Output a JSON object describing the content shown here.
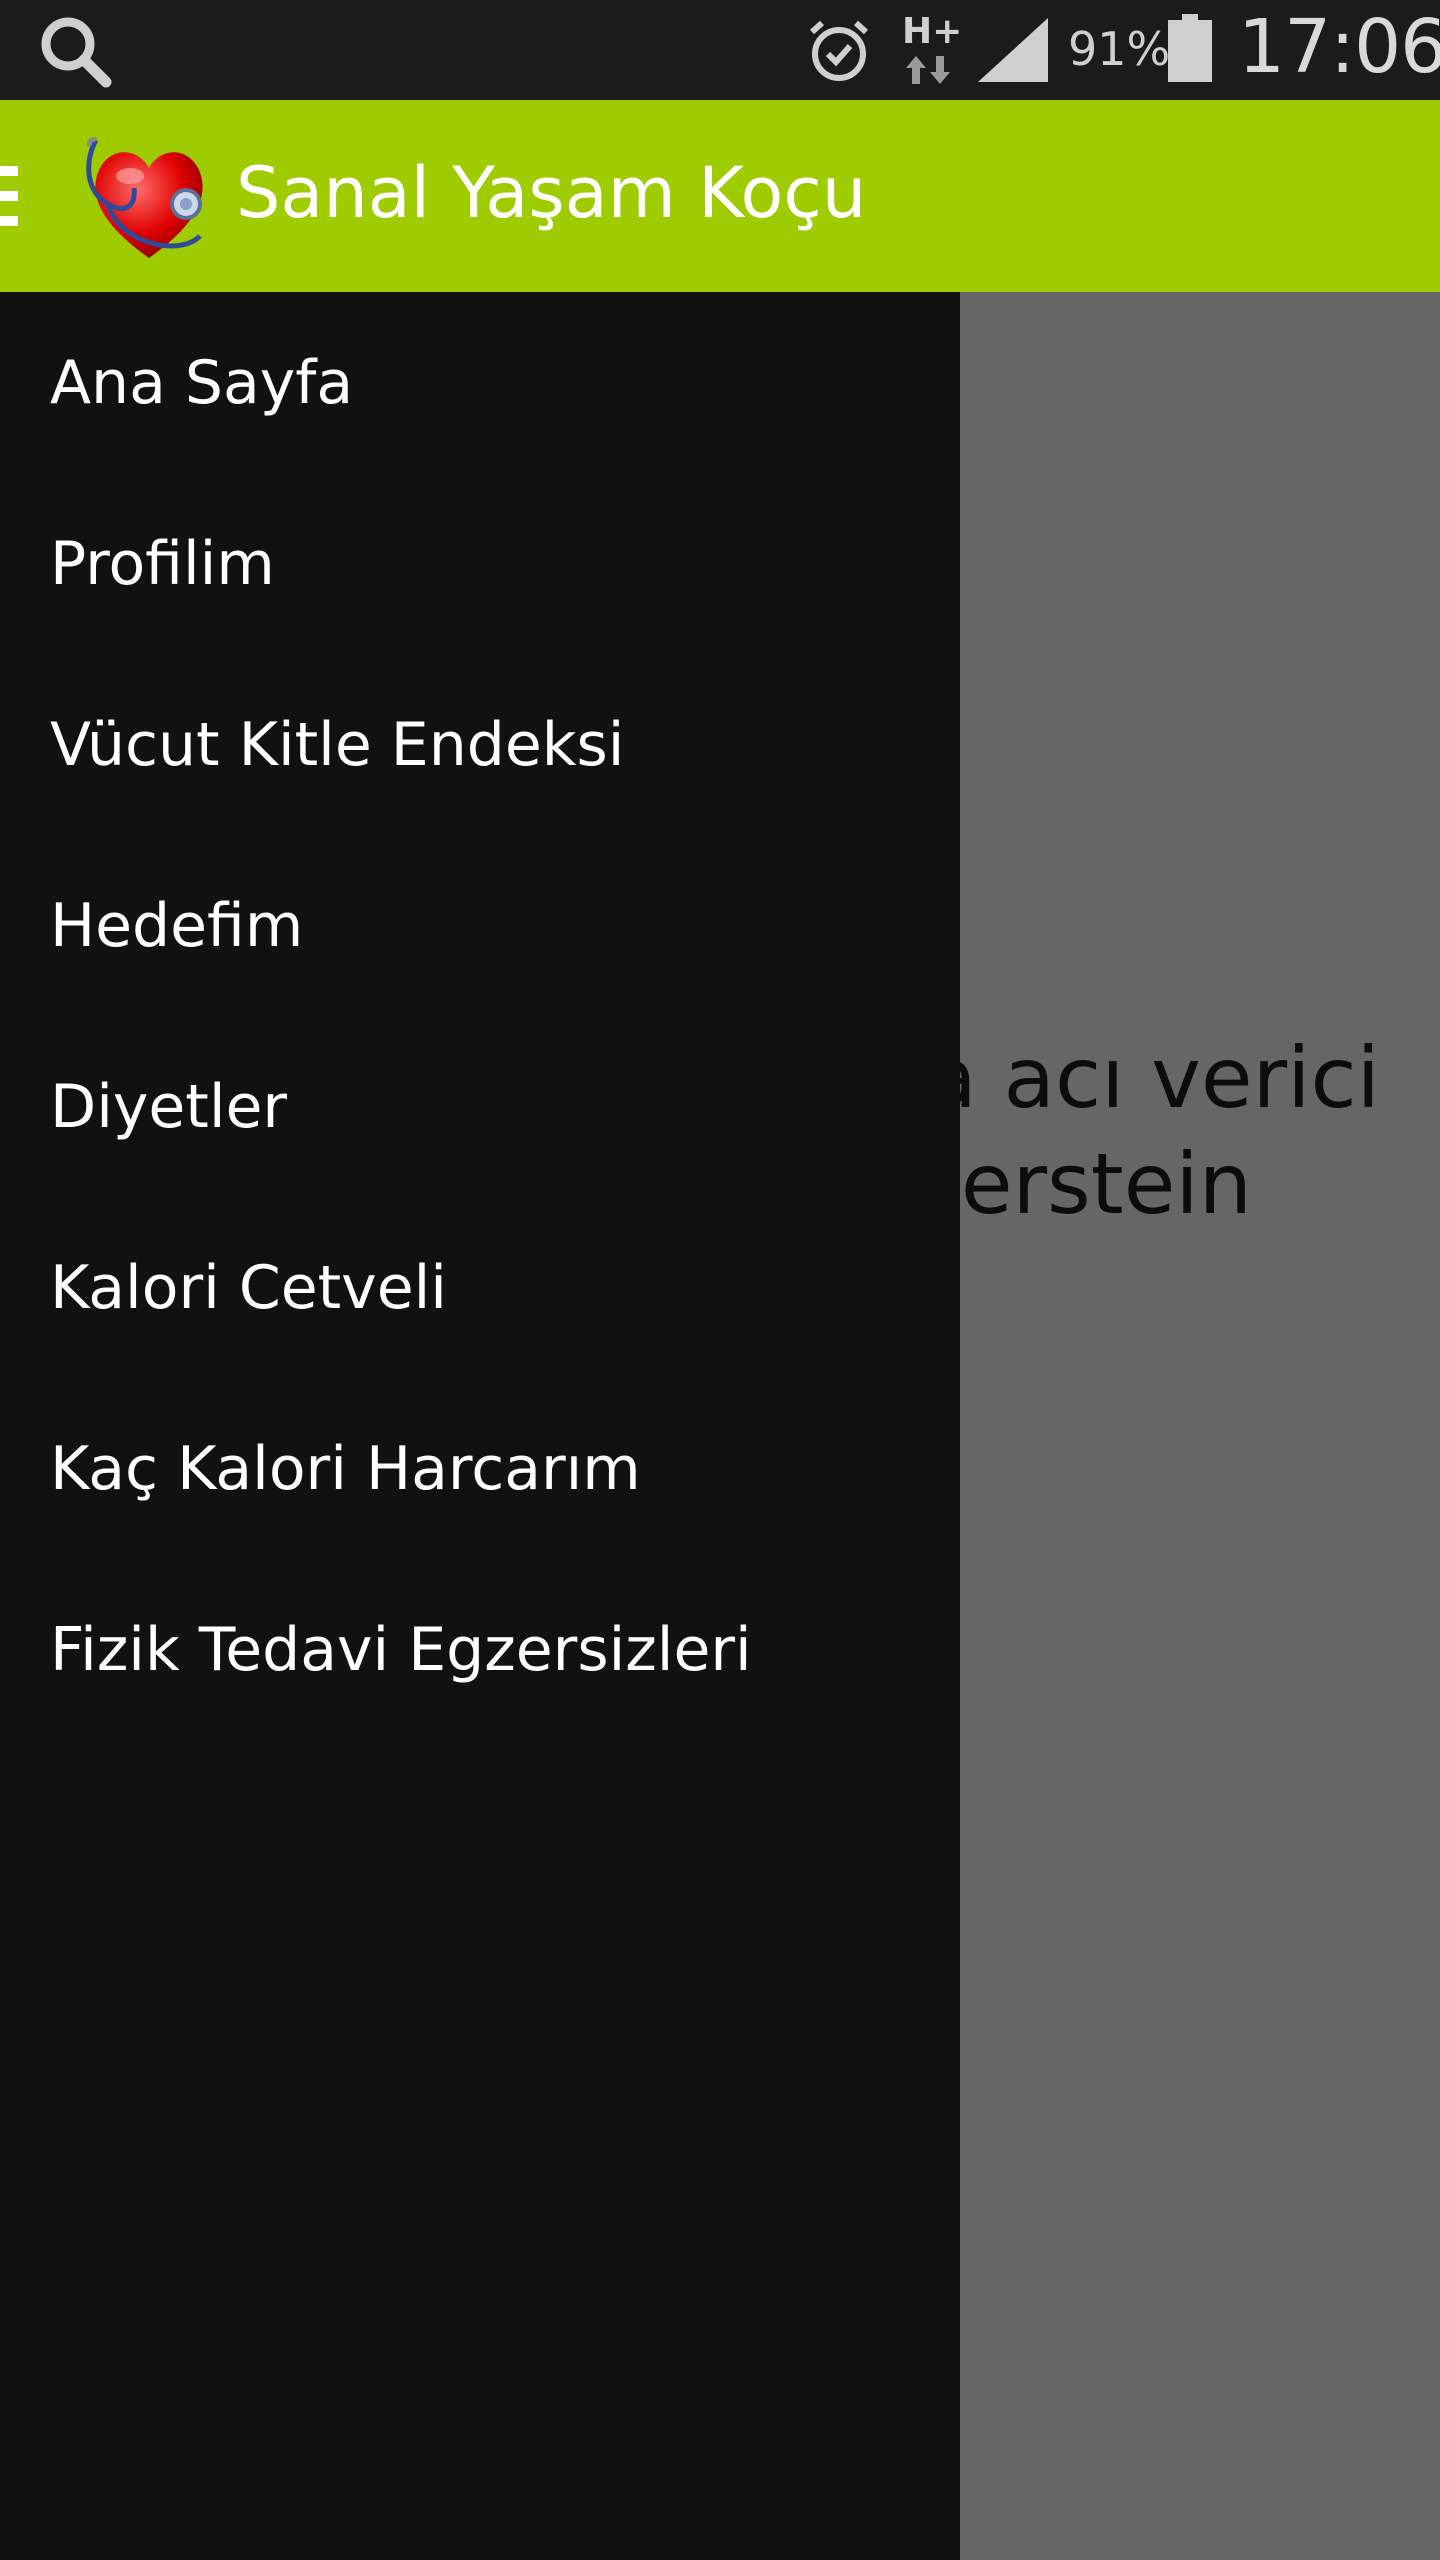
{
  "status_bar": {
    "battery_percent": "91%",
    "network_type": "H+",
    "time": "17:06",
    "icons": [
      "search-icon",
      "alarm-icon",
      "network-hplus-icon",
      "signal-icon",
      "battery-icon"
    ]
  },
  "action_bar": {
    "title": "Sanal Yaşam Koçu",
    "background_color": "#9fcc00",
    "logo_icon": "heart-stethoscope-icon",
    "drawer_indicator_icon": "drawer-indicator-icon"
  },
  "drawer": {
    "background_color": "#111111",
    "items": [
      {
        "label": "Ana Sayfa"
      },
      {
        "label": "Profilim"
      },
      {
        "label": "Vücut Kitle Endeksi"
      },
      {
        "label": "Hedefim"
      },
      {
        "label": "Diyetler"
      },
      {
        "label": "Kalori Cetveli"
      },
      {
        "label": "Kaç Kalori Harcarım"
      },
      {
        "label": "Fizik Tedavi Egzersizleri"
      }
    ]
  },
  "content": {
    "quote_line_1": "a acı verici",
    "quote_line_2": "ierstein"
  }
}
